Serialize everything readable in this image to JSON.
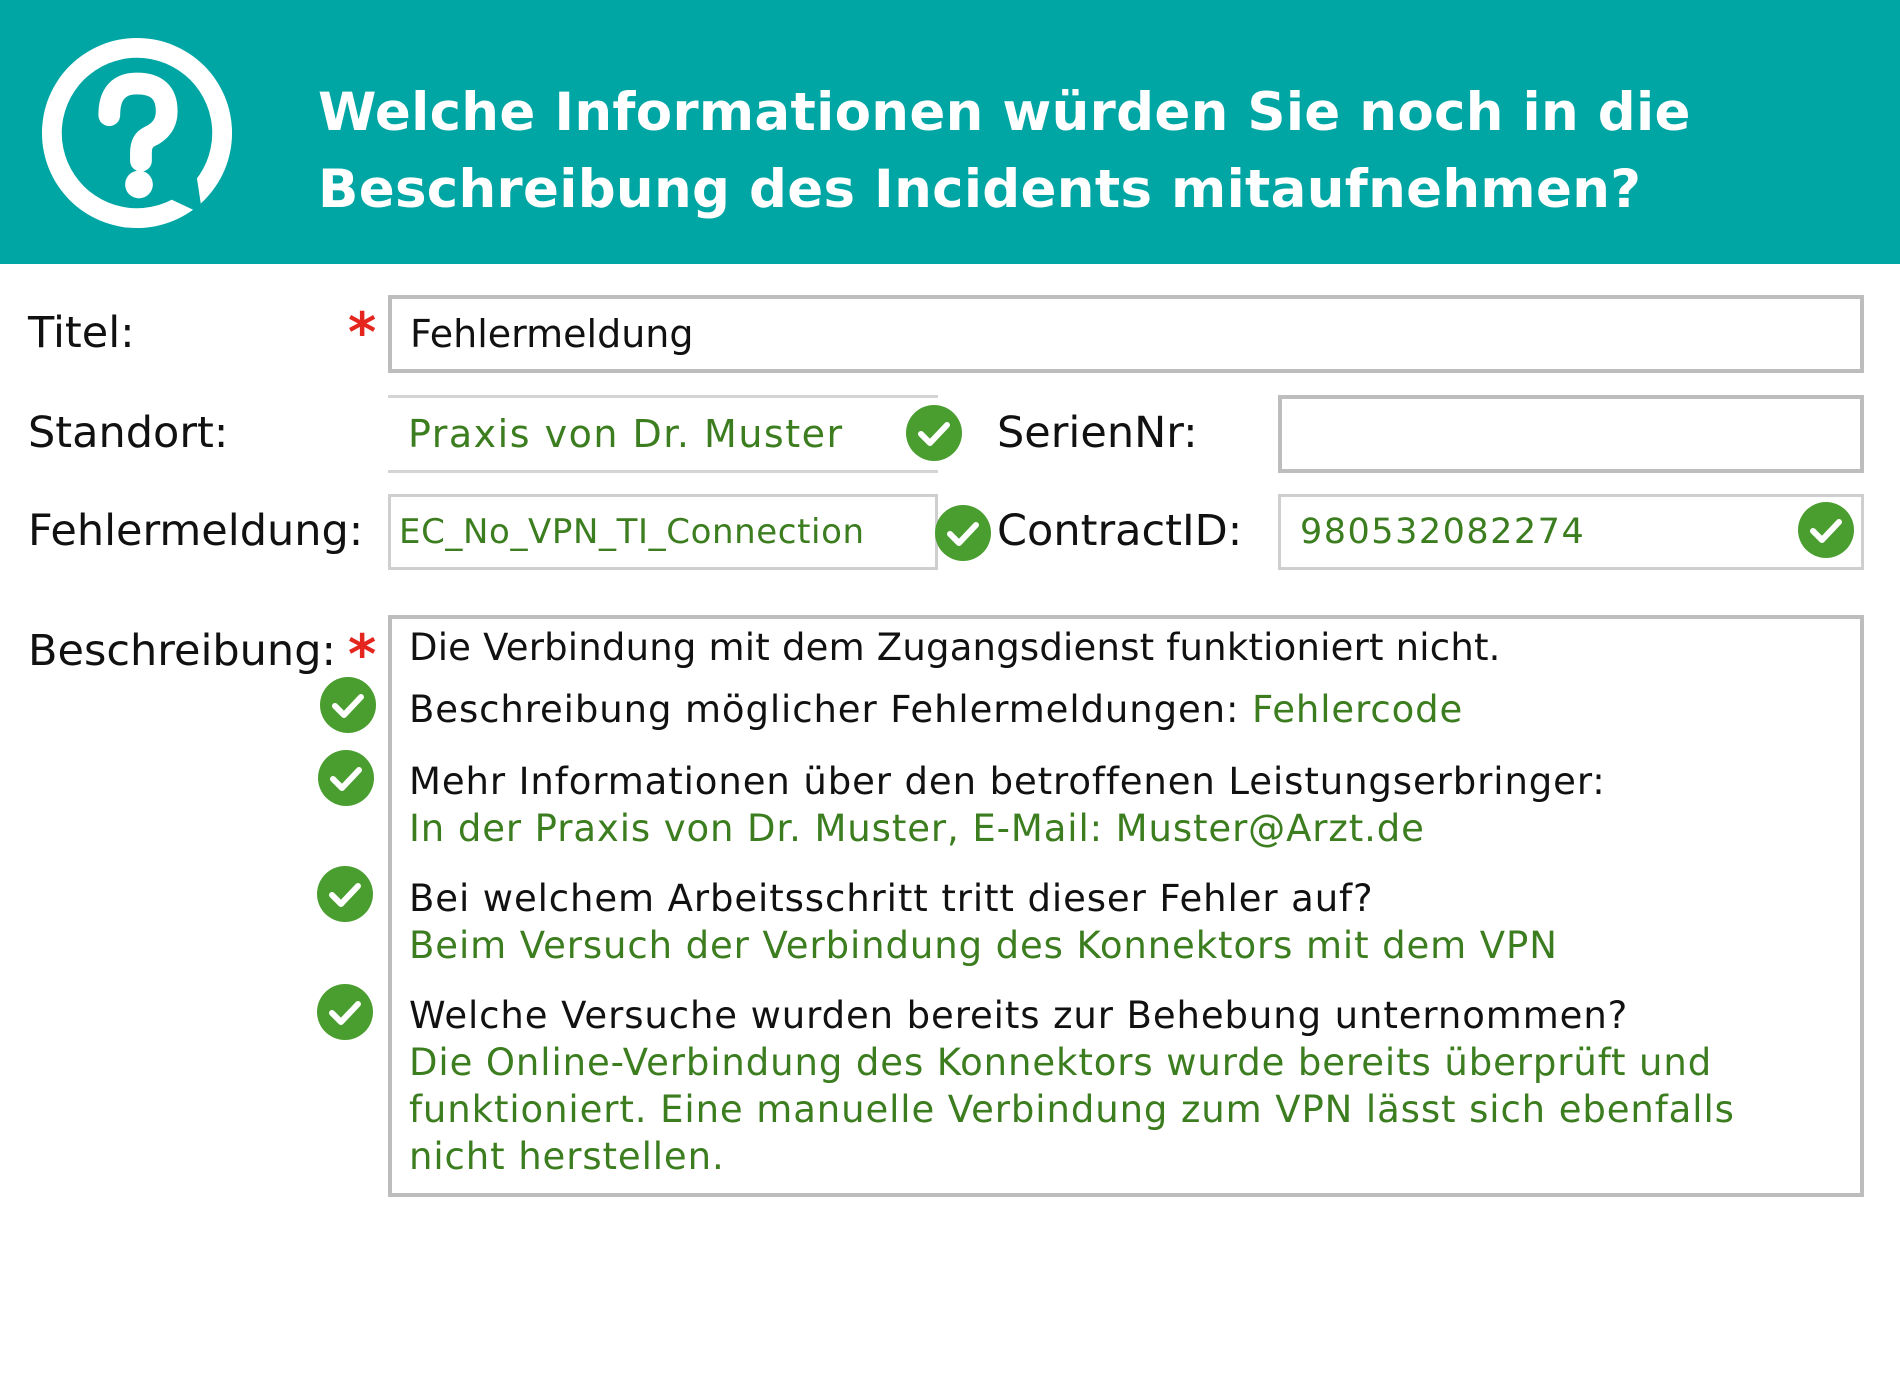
{
  "header": {
    "icon": "question-bubble-icon",
    "title_line1": "Welche Informationen würden Sie noch in die",
    "title_line2": "Beschreibung des Incidents mitaufnehmen?"
  },
  "colors": {
    "header_bg": "#00a6a4",
    "check_green": "#4a9e2f",
    "value_green": "#3b7d1f",
    "required_star": "#e4261f"
  },
  "form": {
    "titel": {
      "label": "Titel:",
      "required": "*",
      "value": "Fehlermeldung"
    },
    "standort": {
      "label": "Standort:",
      "value": "Praxis von Dr. Muster"
    },
    "seriennr": {
      "label": "SerienNr:",
      "value": ""
    },
    "fehlermeldung": {
      "label": "Fehlermeldung:",
      "value": "EC_No_VPN_TI_Connection"
    },
    "contractid": {
      "label": "ContractID:",
      "value": "980532082274"
    },
    "beschreibung": {
      "label": "Beschreibung:",
      "required": "*",
      "intro": "Die Verbindung mit dem Zugangsdienst funktioniert nicht.",
      "items": [
        {
          "question": "Beschreibung möglicher Fehlermeldungen:",
          "answer": "Fehlercode"
        },
        {
          "question": "Mehr Informationen über den betroffenen Leistungserbringer:",
          "answer": "In der Praxis von Dr. Muster, E-Mail: Muster@Arzt.de"
        },
        {
          "question": "Bei welchem Arbeitsschritt tritt dieser Fehler auf?",
          "answer": "Beim Versuch der Verbindung des Konnektors mit dem VPN"
        },
        {
          "question": "Welche Versuche wurden bereits zur Behebung unternommen?",
          "answer_line1": "Die Online-Verbindung des Konnektors wurde bereits überprüft und",
          "answer_line2": "funktioniert. Eine manuelle Verbindung zum VPN lässt sich ebenfalls",
          "answer_line3": "nicht herstellen."
        }
      ]
    }
  }
}
